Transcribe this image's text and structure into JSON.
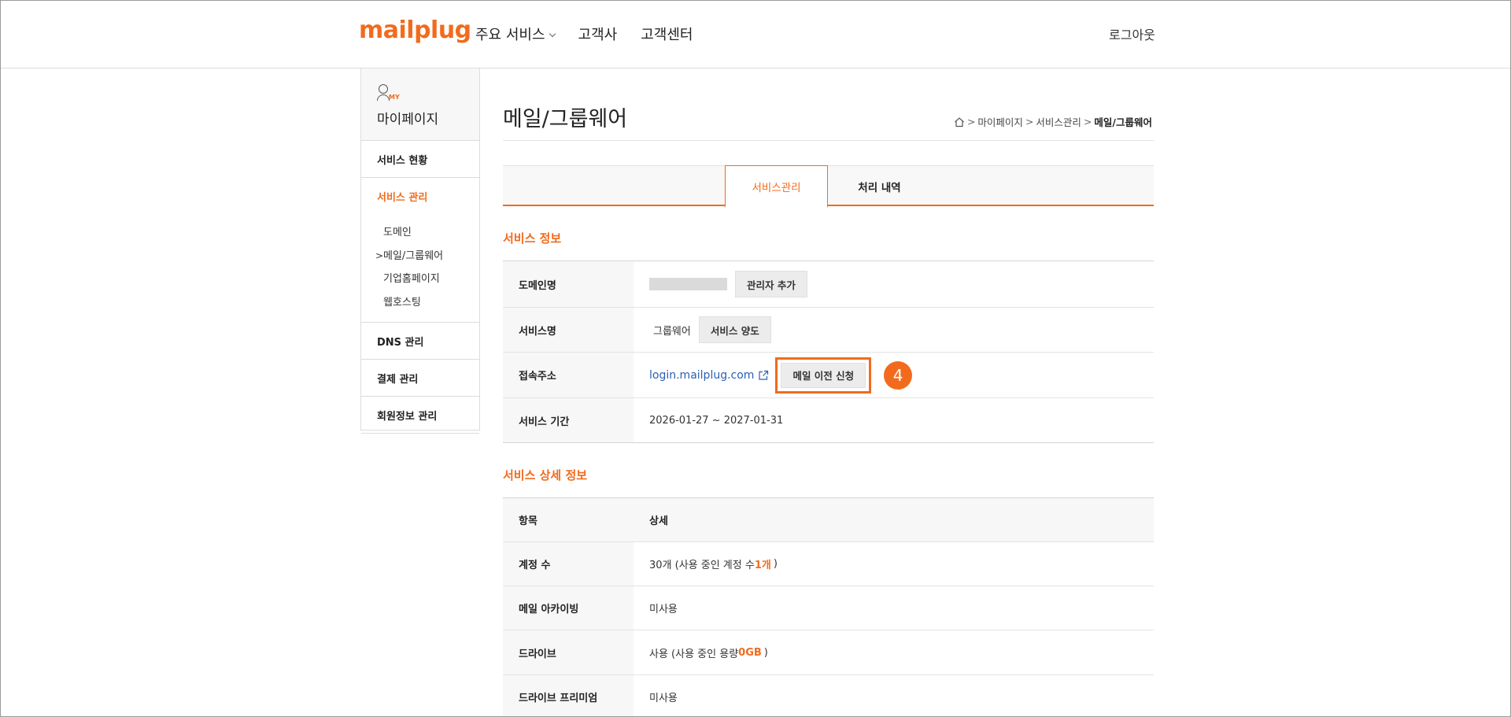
{
  "header": {
    "logo": "mailplug",
    "nav": [
      "주요 서비스",
      "고객사",
      "고객센터"
    ],
    "logout": "로그아웃"
  },
  "sidebar": {
    "title": "마이페이지",
    "my_badge": "MY",
    "items": {
      "status": "서비스 현황",
      "manage": "서비스 관리",
      "dns": "DNS 관리",
      "payment": "결제 관리",
      "member": "회원정보 관리"
    },
    "sub_items": [
      "도메인",
      "메일/그룹웨어",
      "기업홈페이지",
      "웹호스팅"
    ]
  },
  "page": {
    "title": "메일/그룹웨어",
    "breadcrumb": [
      "마이페이지",
      "서비스관리",
      "메일/그룹웨어"
    ]
  },
  "tabs": [
    "서비스관리",
    "처리 내역"
  ],
  "service_info": {
    "section_title": "서비스 정보",
    "rows": {
      "domain_label": "도메인명",
      "domain_button": "관리자 추가",
      "service_label": "서비스명",
      "service_value": "그룹웨어",
      "service_button": "서비스 양도",
      "address_label": "접속주소",
      "address_link": "login.mailplug.com",
      "address_button": "메일 이전 신청",
      "step_badge": "4",
      "period_label": "서비스 기간",
      "period_value": "2026-01-27 ~ 2027-01-31"
    }
  },
  "detail_info": {
    "section_title": "서비스 상세 정보",
    "head": [
      "항목",
      "상세"
    ],
    "accounts_label": "계정 수",
    "accounts_prefix": "30개 (사용 중인 계정 수 ",
    "accounts_highlight": "1개",
    "accounts_suffix": ")",
    "archiving_label": "메일 아카이빙",
    "archiving_value": "미사용",
    "drive_label": "드라이브",
    "drive_prefix": "사용 (사용 중인 용량 ",
    "drive_highlight": "0GB",
    "drive_suffix": ")",
    "premium_label": "드라이브 프리미엄",
    "premium_value": "미사용"
  },
  "colors": {
    "accent": "#f26b1d",
    "link": "#2b5fb5"
  }
}
